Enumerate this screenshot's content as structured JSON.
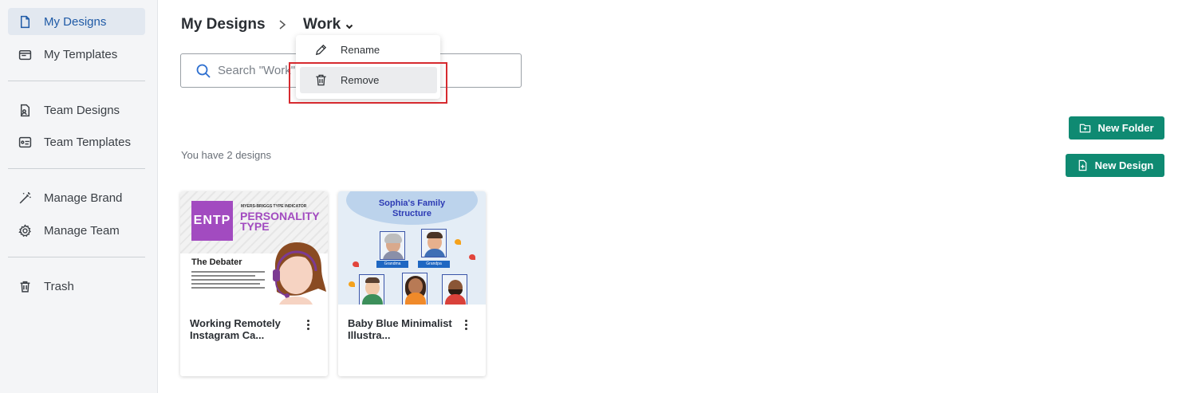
{
  "sidebar": {
    "items": [
      {
        "label": "My Designs",
        "icon": "file-icon"
      },
      {
        "label": "My Templates",
        "icon": "templates-icon"
      },
      {
        "label": "Team Designs",
        "icon": "team-file-icon"
      },
      {
        "label": "Team Templates",
        "icon": "team-templates-icon"
      },
      {
        "label": "Manage Brand",
        "icon": "magic-wand-icon"
      },
      {
        "label": "Manage Team",
        "icon": "gear-icon"
      },
      {
        "label": "Trash",
        "icon": "trash-icon"
      }
    ]
  },
  "header": {
    "root": "My Designs",
    "current": "Work"
  },
  "search": {
    "placeholder": "Search \"Work\""
  },
  "menu": {
    "rename": "Rename",
    "remove": "Remove"
  },
  "buttons": {
    "new_folder": "New Folder",
    "new_design": "New Design"
  },
  "count_text": "You have 2 designs",
  "cards": [
    {
      "title": "Working Remotely Instagram Ca...",
      "thumb": {
        "badge": "ENTP",
        "kicker": "MYERS-BRIGGS TYPE INDICATOR",
        "heading": "PERSONALITY TYPE",
        "subheading": "The Debater"
      }
    },
    {
      "title": "Baby Blue Minimalist Illustra...",
      "thumb": {
        "heading": "Sophia's Family Structure",
        "tags": [
          "Grandma",
          "Grandpa"
        ]
      }
    }
  ],
  "colors": {
    "accent": "#0f8a72",
    "active_nav": "#1f5aa6",
    "highlight": "#d62a2f"
  }
}
